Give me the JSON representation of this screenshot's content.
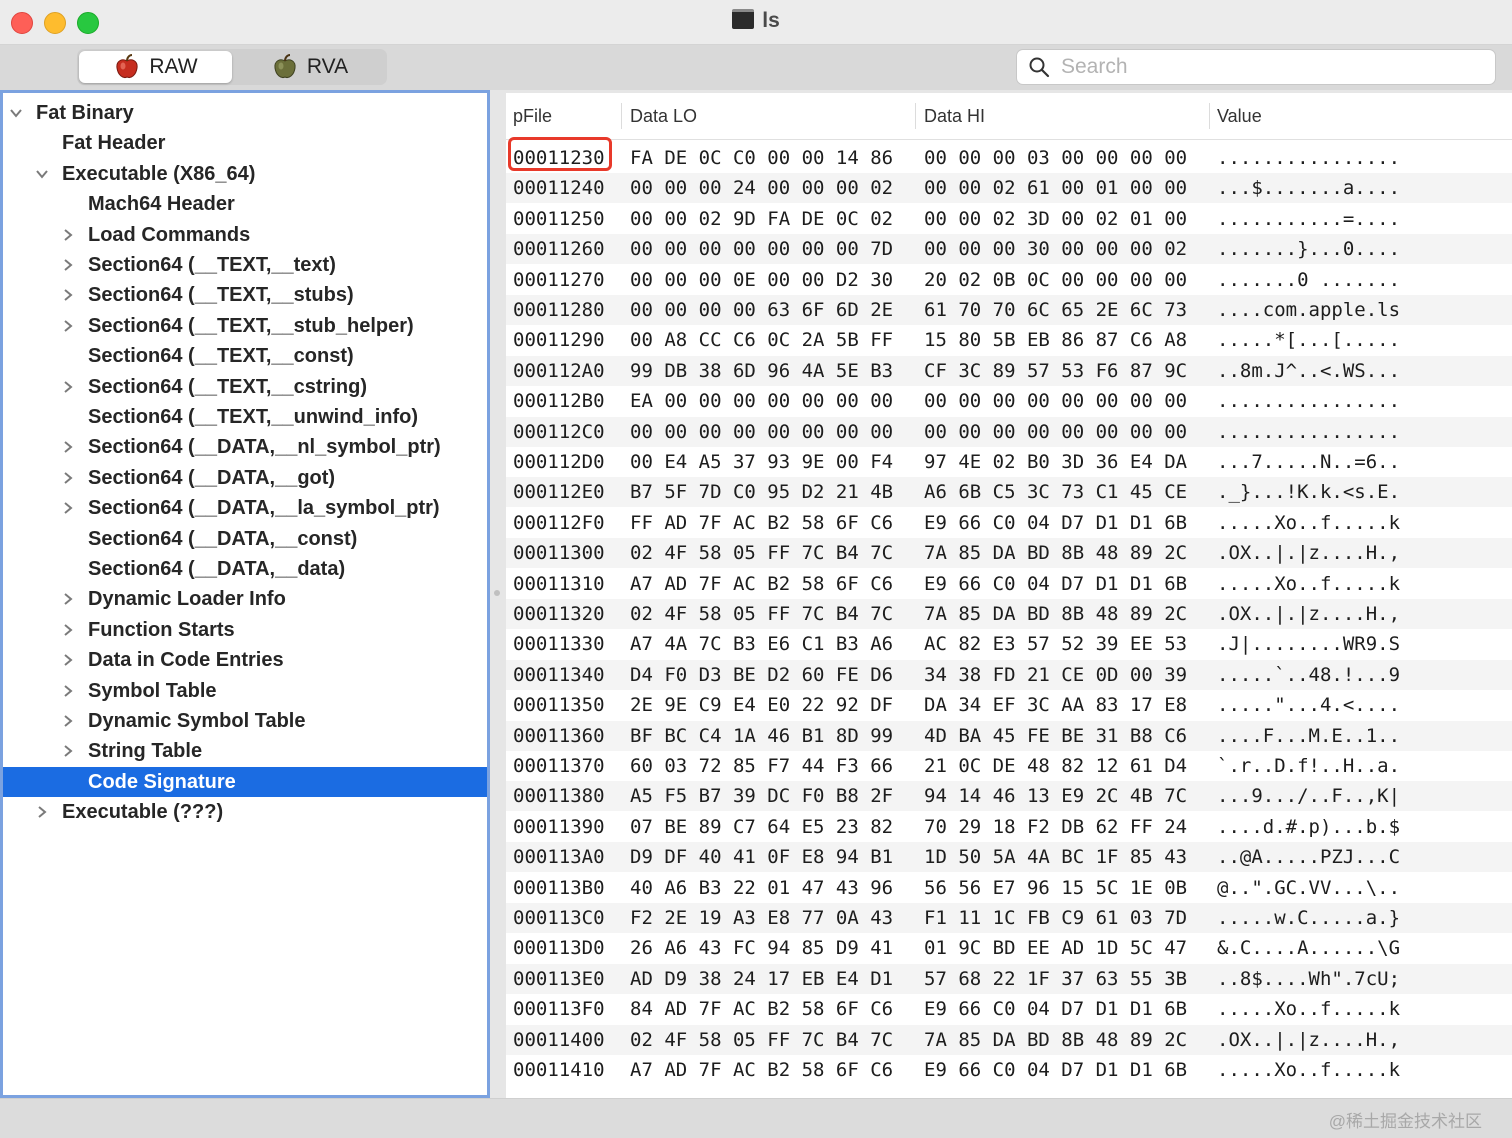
{
  "window": {
    "title": "ls"
  },
  "toolbar": {
    "raw_label": "RAW",
    "rva_label": "RVA",
    "search_placeholder": "Search"
  },
  "sidebar": {
    "items": [
      {
        "label": "Fat Binary",
        "level": 0,
        "chevron": "down"
      },
      {
        "label": "Fat Header",
        "level": 1,
        "chevron": "none"
      },
      {
        "label": "Executable  (X86_64)",
        "level": 1,
        "chevron": "down"
      },
      {
        "label": "Mach64 Header",
        "level": 2,
        "chevron": "none"
      },
      {
        "label": "Load Commands",
        "level": 2,
        "chevron": "right"
      },
      {
        "label": "Section64 (__TEXT,__text)",
        "level": 2,
        "chevron": "right"
      },
      {
        "label": "Section64 (__TEXT,__stubs)",
        "level": 2,
        "chevron": "right"
      },
      {
        "label": "Section64 (__TEXT,__stub_helper)",
        "level": 2,
        "chevron": "right"
      },
      {
        "label": "Section64 (__TEXT,__const)",
        "level": 2,
        "chevron": "none"
      },
      {
        "label": "Section64 (__TEXT,__cstring)",
        "level": 2,
        "chevron": "right"
      },
      {
        "label": "Section64 (__TEXT,__unwind_info)",
        "level": 2,
        "chevron": "none"
      },
      {
        "label": "Section64 (__DATA,__nl_symbol_ptr)",
        "level": 2,
        "chevron": "right"
      },
      {
        "label": "Section64 (__DATA,__got)",
        "level": 2,
        "chevron": "right"
      },
      {
        "label": "Section64 (__DATA,__la_symbol_ptr)",
        "level": 2,
        "chevron": "right"
      },
      {
        "label": "Section64 (__DATA,__const)",
        "level": 2,
        "chevron": "none"
      },
      {
        "label": "Section64 (__DATA,__data)",
        "level": 2,
        "chevron": "none"
      },
      {
        "label": "Dynamic Loader Info",
        "level": 2,
        "chevron": "right"
      },
      {
        "label": "Function Starts",
        "level": 2,
        "chevron": "right"
      },
      {
        "label": "Data in Code Entries",
        "level": 2,
        "chevron": "right"
      },
      {
        "label": "Symbol Table",
        "level": 2,
        "chevron": "right"
      },
      {
        "label": "Dynamic Symbol Table",
        "level": 2,
        "chevron": "right"
      },
      {
        "label": "String Table",
        "level": 2,
        "chevron": "right"
      },
      {
        "label": "Code Signature",
        "level": 2,
        "chevron": "none",
        "selected": true
      },
      {
        "label": "Executable  (???)",
        "level": 1,
        "chevron": "right"
      }
    ]
  },
  "table": {
    "columns": [
      "pFile",
      "Data LO",
      "Data HI",
      "Value"
    ],
    "highlighted_row": 0,
    "rows": [
      [
        "00011230",
        "FA DE 0C C0 00 00 14 86",
        "00 00 00 03 00 00 00 00",
        "................"
      ],
      [
        "00011240",
        "00 00 00 24 00 00 00 02",
        "00 00 02 61 00 01 00 00",
        "...$.......a...."
      ],
      [
        "00011250",
        "00 00 02 9D FA DE 0C 02",
        "00 00 02 3D 00 02 01 00",
        "...........=...."
      ],
      [
        "00011260",
        "00 00 00 00 00 00 00 7D",
        "00 00 00 30 00 00 00 02",
        ".......}...0...."
      ],
      [
        "00011270",
        "00 00 00 0E 00 00 D2 30",
        "20 02 0B 0C 00 00 00 00",
        ".......0 ......."
      ],
      [
        "00011280",
        "00 00 00 00 63 6F 6D 2E",
        "61 70 70 6C 65 2E 6C 73",
        "....com.apple.ls"
      ],
      [
        "00011290",
        "00 A8 CC C6 0C 2A 5B FF",
        "15 80 5B EB 86 87 C6 A8",
        ".....*[...[....."
      ],
      [
        "000112A0",
        "99 DB 38 6D 96 4A 5E B3",
        "CF 3C 89 57 53 F6 87 9C",
        "..8m.J^..<.WS..."
      ],
      [
        "000112B0",
        "EA 00 00 00 00 00 00 00",
        "00 00 00 00 00 00 00 00",
        "................"
      ],
      [
        "000112C0",
        "00 00 00 00 00 00 00 00",
        "00 00 00 00 00 00 00 00",
        "................"
      ],
      [
        "000112D0",
        "00 E4 A5 37 93 9E 00 F4",
        "97 4E 02 B0 3D 36 E4 DA",
        "...7.....N..=6.."
      ],
      [
        "000112E0",
        "B7 5F 7D C0 95 D2 21 4B",
        "A6 6B C5 3C 73 C1 45 CE",
        "._}...!K.k.<s.E."
      ],
      [
        "000112F0",
        "FF AD 7F AC B2 58 6F C6",
        "E9 66 C0 04 D7 D1 D1 6B",
        ".....Xo..f.....k"
      ],
      [
        "00011300",
        "02 4F 58 05 FF 7C B4 7C",
        "7A 85 DA BD 8B 48 89 2C",
        ".OX..|.|z....H.,"
      ],
      [
        "00011310",
        "A7 AD 7F AC B2 58 6F C6",
        "E9 66 C0 04 D7 D1 D1 6B",
        ".....Xo..f.....k"
      ],
      [
        "00011320",
        "02 4F 58 05 FF 7C B4 7C",
        "7A 85 DA BD 8B 48 89 2C",
        ".OX..|.|z....H.,"
      ],
      [
        "00011330",
        "A7 4A 7C B3 E6 C1 B3 A6",
        "AC 82 E3 57 52 39 EE 53",
        ".J|........WR9.S"
      ],
      [
        "00011340",
        "D4 F0 D3 BE D2 60 FE D6",
        "34 38 FD 21 CE 0D 00 39",
        ".....`..48.!...9"
      ],
      [
        "00011350",
        "2E 9E C9 E4 E0 22 92 DF",
        "DA 34 EF 3C AA 83 17 E8",
        ".....\"...4.<...."
      ],
      [
        "00011360",
        "BF BC C4 1A 46 B1 8D 99",
        "4D BA 45 FE BE 31 B8 C6",
        "....F...M.E..1.."
      ],
      [
        "00011370",
        "60 03 72 85 F7 44 F3 66",
        "21 0C DE 48 82 12 61 D4",
        "`.r..D.f!..H..a."
      ],
      [
        "00011380",
        "A5 F5 B7 39 DC F0 B8 2F",
        "94 14 46 13 E9 2C 4B 7C",
        "...9.../..F..,K|"
      ],
      [
        "00011390",
        "07 BE 89 C7 64 E5 23 82",
        "70 29 18 F2 DB 62 FF 24",
        "....d.#.p)...b.$"
      ],
      [
        "000113A0",
        "D9 DF 40 41 0F E8 94 B1",
        "1D 50 5A 4A BC 1F 85 43",
        "..@A.....PZJ...C"
      ],
      [
        "000113B0",
        "40 A6 B3 22 01 47 43 96",
        "56 56 E7 96 15 5C 1E 0B",
        "@..\".GC.VV...\\.."
      ],
      [
        "000113C0",
        "F2 2E 19 A3 E8 77 0A 43",
        "F1 11 1C FB C9 61 03 7D",
        ".....w.C.....a.}"
      ],
      [
        "000113D0",
        "26 A6 43 FC 94 85 D9 41",
        "01 9C BD EE AD 1D 5C 47",
        "&.C....A......\\G"
      ],
      [
        "000113E0",
        "AD D9 38 24 17 EB E4 D1",
        "57 68 22 1F 37 63 55 3B",
        "..8$....Wh\".7cU;"
      ],
      [
        "000113F0",
        "84 AD 7F AC B2 58 6F C6",
        "E9 66 C0 04 D7 D1 D1 6B",
        ".....Xo..f.....k"
      ],
      [
        "00011400",
        "02 4F 58 05 FF 7C B4 7C",
        "7A 85 DA BD 8B 48 89 2C",
        ".OX..|.|z....H.,"
      ],
      [
        "00011410",
        "A7 AD 7F AC B2 58 6F C6",
        "E9 66 C0 04 D7 D1 D1 6B",
        ".....Xo..f.....k"
      ]
    ]
  },
  "watermark": "@稀土掘金技术社区",
  "colors": {
    "selection": "#1b6ce2",
    "highlight_box": "#e8392a",
    "sidebar_focus_border": "#7ba2e0"
  }
}
